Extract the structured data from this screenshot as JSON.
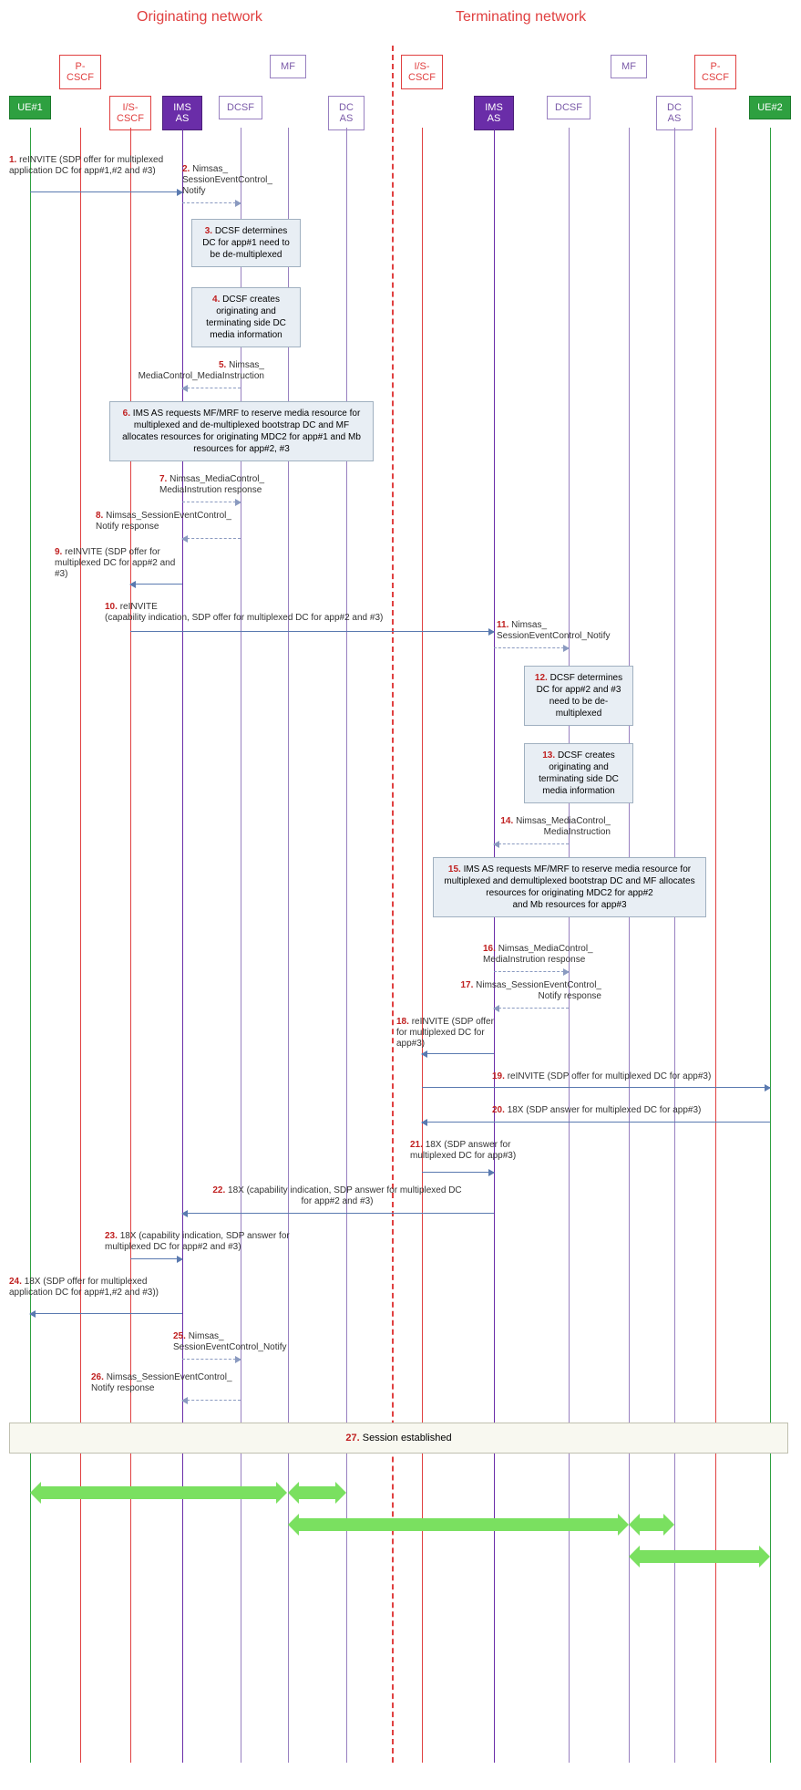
{
  "networks": {
    "originating": "Originating network",
    "terminating": "Terminating network"
  },
  "actors": {
    "ue1": "UE#1",
    "pcscf_o": "P-\nCSCF",
    "iscscf_o": "I/S-\nCSCF",
    "imsas_o": "IMS\nAS",
    "dcsf_o": "DCSF",
    "mf_o": "MF",
    "dcas_o": "DC\nAS",
    "iscscf_t": "I/S-\nCSCF",
    "imsas_t": "IMS\nAS",
    "dcsf_t": "DCSF",
    "mf_t": "MF",
    "dcas_t": "DC\nAS",
    "pcscf_t": "P-\nCSCF",
    "ue2": "UE#2"
  },
  "steps": {
    "s1": {
      "n": "1.",
      "t": "reINVITE (SDP offer for multiplexed application DC for app#1,#2 and #3)"
    },
    "s2": {
      "n": "2.",
      "t": "Nimsas_\nSessionEventControl_\nNotify"
    },
    "s3": {
      "n": "3.",
      "t": "DCSF determines DC for app#1 need to be de-multiplexed"
    },
    "s4": {
      "n": "4.",
      "t": "DCSF creates originating and terminating side DC media information"
    },
    "s5": {
      "n": "5.",
      "t": "Nimsas_\nMediaControl_MediaInstruction"
    },
    "s6": {
      "n": "6.",
      "t": "IMS AS requests MF/MRF to reserve media resource for multiplexed and de-multiplexed bootstrap DC and MF allocates resources for originating MDC2 for app#1 and Mb resources for app#2, #3"
    },
    "s7": {
      "n": "7.",
      "t": "Nimsas_MediaControl_\nMediaInstrution response"
    },
    "s8": {
      "n": "8.",
      "t": "Nimsas_SessionEventControl_\nNotify response"
    },
    "s9": {
      "n": "9.",
      "t": "reINVITE (SDP offer for multiplexed DC for app#2 and #3)"
    },
    "s10": {
      "n": "10.",
      "t": "reINVITE\n(capability indication, SDP offer for multiplexed DC for app#2 and #3)"
    },
    "s11": {
      "n": "11.",
      "t": "Nimsas_\nSessionEventControl_Notify"
    },
    "s12": {
      "n": "12.",
      "t": "DCSF determines DC for app#2 and #3 need to be de-multiplexed"
    },
    "s13": {
      "n": "13.",
      "t": "DCSF creates originating and terminating side DC media information"
    },
    "s14": {
      "n": "14.",
      "t": "Nimsas_MediaControl_\nMediaInstruction"
    },
    "s15": {
      "n": "15.",
      "t": "IMS AS requests MF/MRF to reserve media resource for multiplexed and demultiplexed bootstrap DC and MF allocates resources for originating MDC2 for app#2\nand Mb resources for app#3"
    },
    "s16": {
      "n": "16.",
      "t": "Nimsas_MediaControl_\nMediaInstrution response"
    },
    "s17": {
      "n": "17.",
      "t": "Nimsas_SessionEventControl_\nNotify response"
    },
    "s18": {
      "n": "18.",
      "t": "reINVITE (SDP offer for multiplexed DC for app#3)"
    },
    "s19": {
      "n": "19.",
      "t": "reINVITE (SDP offer for multiplexed DC for app#3)"
    },
    "s20": {
      "n": "20.",
      "t": "18X (SDP answer for multiplexed DC for app#3)"
    },
    "s21": {
      "n": "21.",
      "t": "18X (SDP answer for multiplexed DC for app#3)"
    },
    "s22": {
      "n": "22.",
      "t": "18X (capability indication, SDP answer for multiplexed DC for app#2 and #3)"
    },
    "s23": {
      "n": "23.",
      "t": "18X (capability indication, SDP answer for multiplexed DC for app#2 and #3)"
    },
    "s24": {
      "n": "24.",
      "t": "18X (SDP offer for multiplexed application DC for app#1,#2 and #3))"
    },
    "s25": {
      "n": "25.",
      "t": "Nimsas_\nSessionEventControl_Notify"
    },
    "s26": {
      "n": "26.",
      "t": "Nimsas_SessionEventControl_\nNotify response"
    },
    "s27": {
      "n": "27.",
      "t": "Session established"
    }
  }
}
